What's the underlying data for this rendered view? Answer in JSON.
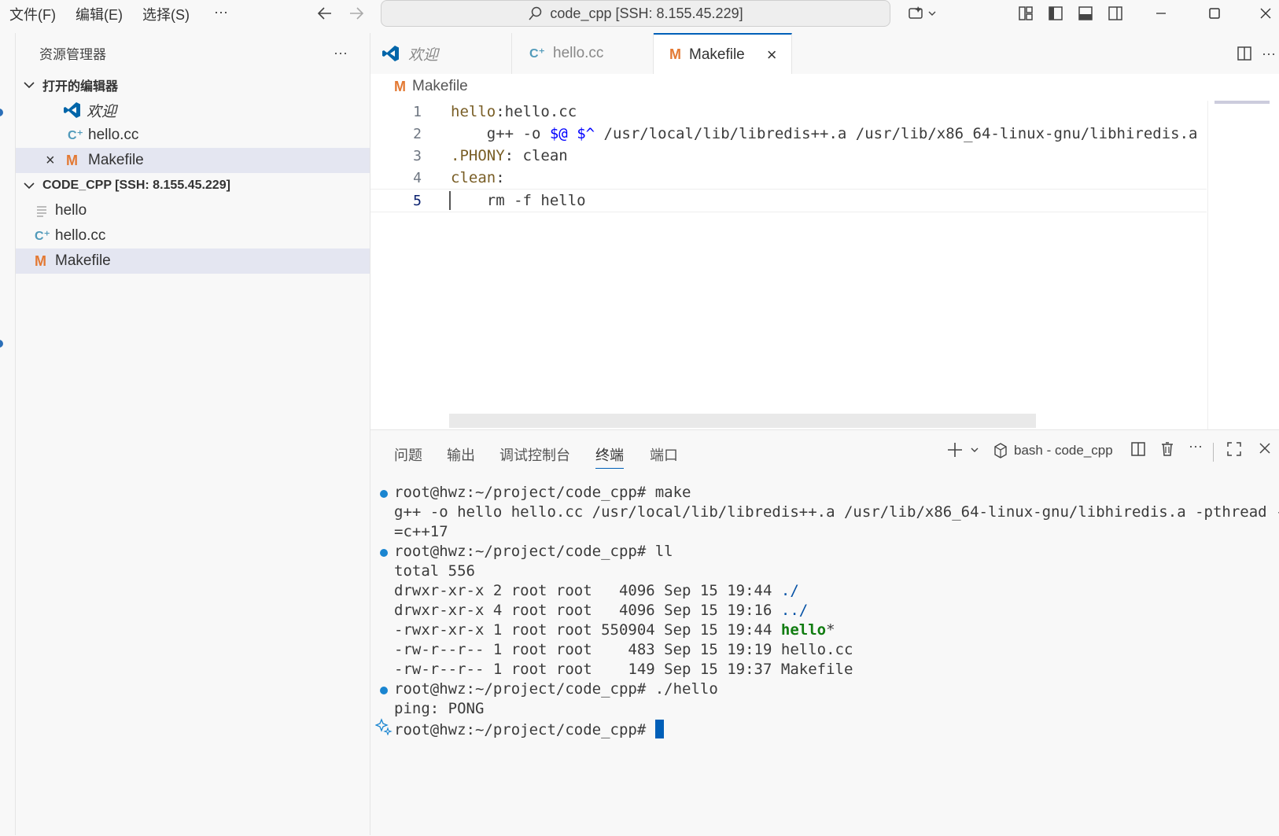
{
  "titlebar": {
    "menu": [
      "文件(F)",
      "编辑(E)",
      "选择(S)",
      "···"
    ],
    "search_text": "code_cpp [SSH: 8.155.45.229]"
  },
  "sidebar": {
    "title": "资源管理器",
    "more": "···",
    "open_editors_title": "打开的编辑器",
    "open_editors": [
      "欢迎",
      "hello.cc",
      "Makefile"
    ],
    "close_glyph": "×",
    "folder_title": "CODE_CPP [SSH: 8.155.45.229]",
    "files": [
      "hello",
      "hello.cc",
      "Makefile"
    ]
  },
  "tabs": [
    {
      "label": "欢迎",
      "icon": "vscode-icon",
      "active": false
    },
    {
      "label": "hello.cc",
      "icon": "cpp-icon",
      "active": false
    },
    {
      "label": "Makefile",
      "icon": "makefile-icon",
      "active": true
    }
  ],
  "tab_close": "×",
  "breadcrumb": "Makefile",
  "editor": {
    "line_numbers": [
      "1",
      "2",
      "3",
      "4",
      "5"
    ],
    "lines": [
      {
        "a": "hello",
        "b": ":hello.cc"
      },
      {
        "a": "    g++ -o ",
        "var1": "$@",
        "mid": " ",
        "var2": "$^",
        "rest": " /usr/local/lib/libredis++.a /usr/lib/x86_64-linux-gnu/libhiredis.a"
      },
      {
        "a": ".PHONY",
        "b": ": clean"
      },
      {
        "a": "clean",
        "b": ":"
      },
      {
        "a": "    rm -f hello"
      }
    ],
    "active_line": 5
  },
  "panel": {
    "tabs": [
      "问题",
      "输出",
      "调试控制台",
      "终端",
      "端口"
    ],
    "active_tab": "终端",
    "terminal_name": "bash - code_cpp",
    "more": "···"
  },
  "terminal": {
    "prompt": "root@hwz:~/project/code_cpp# ",
    "cmd1": "make",
    "out1a": "g++ -o hello hello.cc /usr/local/lib/libredis++.a /usr/lib/x86_64-linux-gnu/libhiredis.a -pthread -std",
    "out1b": "=c++17",
    "cmd2": "ll",
    "total": "total 556",
    "ls": [
      {
        "meta": "drwxr-xr-x 2 root root   4096 Sep 15 19:44 ",
        "name": "./",
        "suffix": ""
      },
      {
        "meta": "drwxr-xr-x 4 root root   4096 Sep 15 19:16 ",
        "name": "../",
        "suffix": ""
      },
      {
        "meta": "-rwxr-xr-x 1 root root 550904 Sep 15 19:44 ",
        "name": "hello",
        "suffix": "*"
      },
      {
        "meta": "-rw-r--r-- 1 root root    483 Sep 15 19:19 ",
        "name": "hello.cc",
        "suffix": ""
      },
      {
        "meta": "-rw-r--r-- 1 root root    149 Sep 15 19:37 ",
        "name": "Makefile",
        "suffix": ""
      }
    ],
    "cmd3": "./hello",
    "out3": "ping: PONG"
  },
  "colors": {
    "accent": "#005fb8",
    "makefile": "#e37933",
    "cpp": "#519aba",
    "vscode": "#0065a9",
    "exec": "#107c10",
    "dir": "#0451a5"
  }
}
